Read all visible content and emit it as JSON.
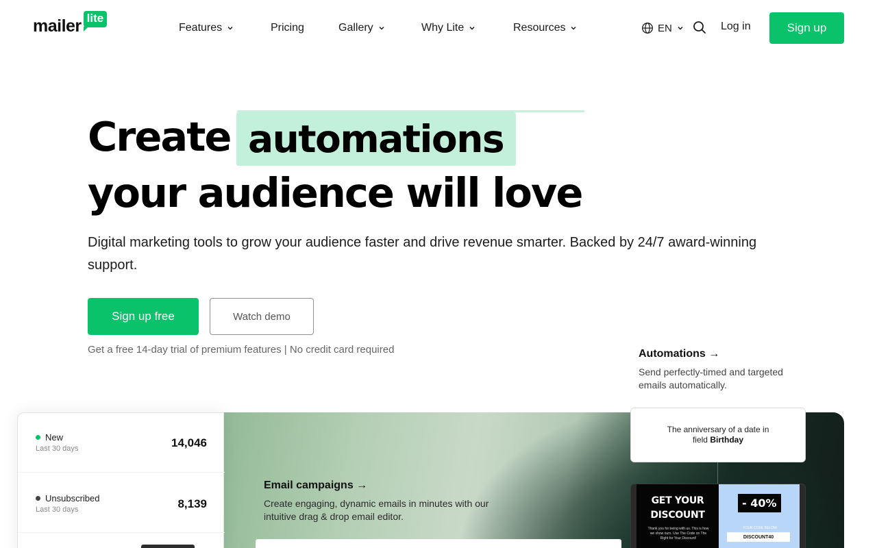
{
  "header": {
    "logo_word": "mailer",
    "logo_badge": "lite",
    "nav": [
      {
        "label": "Features"
      },
      {
        "label": "Pricing"
      },
      {
        "label": "Gallery"
      },
      {
        "label": "Why Lite"
      },
      {
        "label": "Resources"
      }
    ],
    "language": "EN",
    "login_label": "Log in",
    "signup_label": "Sign up"
  },
  "hero": {
    "headline_part1": "Create",
    "headline_highlight": "automations",
    "headline_line2": "your audience will love",
    "subtitle": "Digital marketing tools to grow your audience faster and drive revenue smarter. Backed by 24/7 award-winning support.",
    "primary_cta": "Sign up free",
    "secondary_cta": "Watch demo",
    "trial_note": "Get a free 14-day trial of premium features | No credit card required"
  },
  "features": {
    "automations": {
      "title": "Automations →",
      "description": "Send perfectly-timed and targeted emails automatically."
    },
    "campaigns": {
      "title": "Email campaigns →",
      "description": "Create engaging, dynamic emails in minutes with our intuitive drag & drop email editor."
    }
  },
  "stats": [
    {
      "label": "New",
      "period": "Last 30 days",
      "value": "14,046",
      "dot_color": "#09c269"
    },
    {
      "label": "Unsubscribed",
      "period": "Last 30 days",
      "value": "8,139",
      "dot_color": "#444444"
    }
  ],
  "automation_trigger": {
    "text": "The anniversary of a date in field",
    "field": "Birthday"
  },
  "discount_preview": {
    "headline": "GET YOUR DISCOUNT",
    "small_text": "Thank you for being with us. This is how we show ours. Use The Code on The Right for Your Discount!",
    "percent": "- 40%",
    "code_label": "YOUR CODE BELOW",
    "code": "DISCOUNT40"
  },
  "colors": {
    "brand_green": "#09c269",
    "highlight_mint": "#c3f0da",
    "dark_panel": "#121e1a"
  },
  "icons": [
    "chevron-down-icon",
    "globe-icon",
    "search-icon",
    "arrow-right-icon"
  ]
}
